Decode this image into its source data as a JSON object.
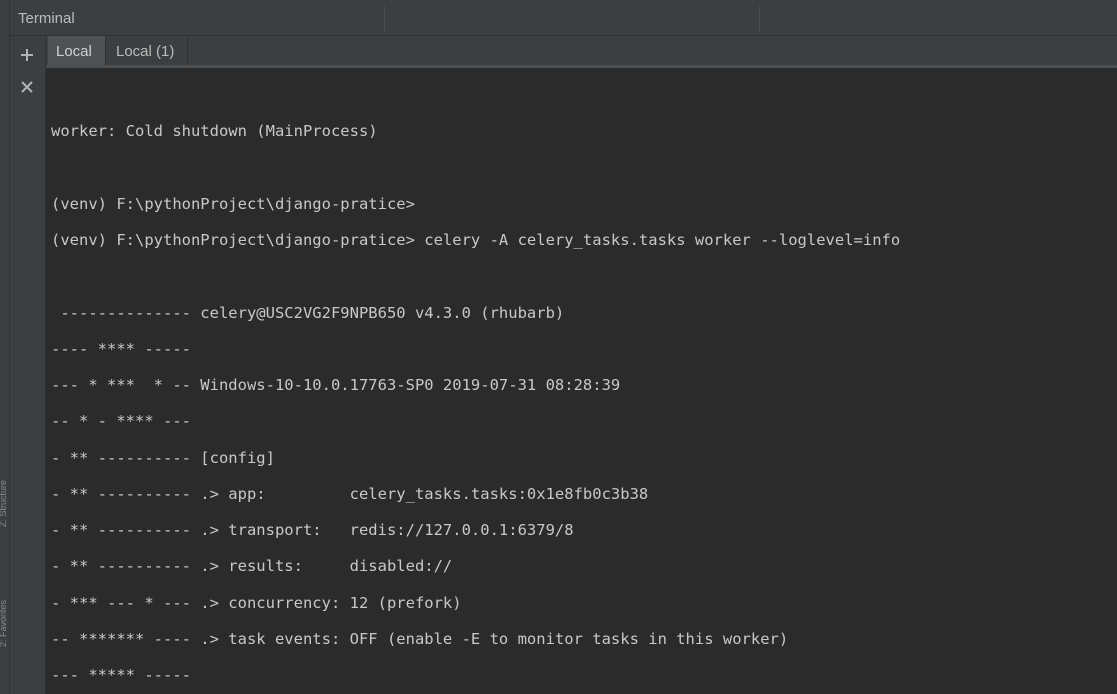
{
  "window": {
    "title": "Terminal"
  },
  "toolbar": {
    "new_session_icon": "plus-icon",
    "close_session_icon": "close-icon"
  },
  "tabs": [
    {
      "label": "Local",
      "active": true
    },
    {
      "label": "Local (1)",
      "active": false
    }
  ],
  "side_panel_labels": [
    "Z: Structure",
    "2: Favorites"
  ],
  "terminal_lines": [
    "worker: Cold shutdown (MainProcess)",
    "",
    "(venv) F:\\pythonProject\\django-pratice>",
    "(venv) F:\\pythonProject\\django-pratice> celery -A celery_tasks.tasks worker --loglevel=info",
    "",
    " -------------- celery@USC2VG2F9NPB650 v4.3.0 (rhubarb)",
    "---- **** -----",
    "--- * ***  * -- Windows-10-10.0.17763-SP0 2019-07-31 08:28:39",
    "-- * - **** ---",
    "- ** ---------- [config]",
    "- ** ---------- .> app:         celery_tasks.tasks:0x1e8fb0c3b38",
    "- ** ---------- .> transport:   redis://127.0.0.1:6379/8",
    "- ** ---------- .> results:     disabled://",
    "- *** --- * --- .> concurrency: 12 (prefork)",
    "-- ******* ---- .> task events: OFF (enable -E to monitor tasks in this worker)",
    "--- ***** -----"
  ],
  "colors": {
    "background": "#2b2b2b",
    "panel": "#3c3f41",
    "text": "#c8c8c8"
  }
}
